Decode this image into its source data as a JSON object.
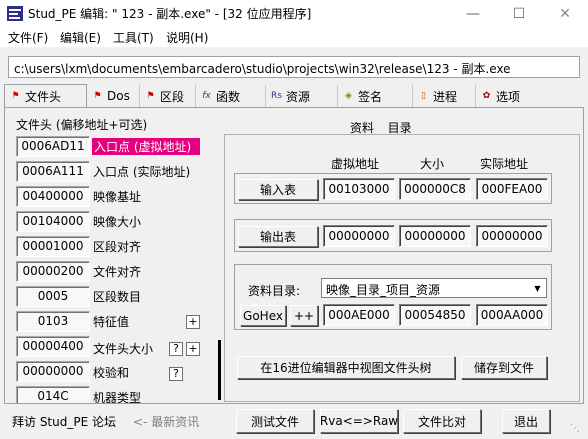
{
  "window": {
    "title": "Stud_PE 编辑: \"     123 - 副本.exe\" - [32 位应用程序]",
    "controls": {
      "minimize": "—",
      "maximize": "☐",
      "close": "✕"
    }
  },
  "menu": [
    "文件(F)",
    "编辑(E)",
    "工具(T)",
    "说明(H)"
  ],
  "path": "c:\\users\\lxm\\documents\\embarcadero\\studio\\projects\\win32\\release\\123 - 副本.exe",
  "tabs": [
    {
      "label": "文件头",
      "icon": "file-header-icon",
      "active": true
    },
    {
      "label": "Dos",
      "icon": "dos-icon"
    },
    {
      "label": "区段",
      "icon": "sections-icon"
    },
    {
      "label": "函数",
      "icon": "functions-icon"
    },
    {
      "label": "资源",
      "icon": "resources-icon"
    },
    {
      "label": "签名",
      "icon": "signature-icon"
    },
    {
      "label": "进程",
      "icon": "process-icon"
    },
    {
      "label": "选项",
      "icon": "options-icon"
    }
  ],
  "left": {
    "header": "文件头 (偏移地址+可选)",
    "fields": [
      {
        "value": "0006AD11",
        "label": "入口点 (虚拟地址)",
        "highlight": true
      },
      {
        "value": "0006A111",
        "label": "入口点 (实际地址)"
      },
      {
        "value": "00400000",
        "label": "映像基址"
      },
      {
        "value": "00104000",
        "label": "映像大小"
      },
      {
        "value": "00001000",
        "label": "区段对齐"
      },
      {
        "value": "00000200",
        "label": "文件对齐"
      },
      {
        "value": "0005",
        "label": "区段数目"
      },
      {
        "value": "0103",
        "label": "特征值",
        "btn": "+"
      },
      {
        "value": "00000400",
        "label": "文件头大小",
        "btn": "?",
        "btn2": "+"
      },
      {
        "value": "00000000",
        "label": "校验和",
        "btn": "?"
      },
      {
        "value": "014C",
        "label": "机器类型"
      }
    ]
  },
  "right": {
    "title": "资料 _ 目录",
    "col_headers": [
      "虚拟地址",
      "大小",
      "实际地址"
    ],
    "import": {
      "button": "输入表",
      "values": [
        "00103000",
        "000000C8",
        "000FEA00"
      ]
    },
    "export": {
      "button": "输出表",
      "values": [
        "00000000",
        "00000000",
        "00000000"
      ]
    },
    "dir": {
      "label": "资料目录:",
      "selected": "映像_目录_项目_资源",
      "gohex": "GoHex",
      "plusplus": "++",
      "values": [
        "000AE000",
        "00054850",
        "000AA000"
      ]
    },
    "view_hex_button": "在16进位编辑器中视图文件头树",
    "save_button": "储存到文件"
  },
  "bottom": {
    "visit": "拜访 Stud_PE 论坛",
    "news": "<- 最新资讯",
    "test_file": "测试文件",
    "rva_raw": "Rva<=>Raw",
    "compare": "文件比对",
    "exit": "退出"
  }
}
